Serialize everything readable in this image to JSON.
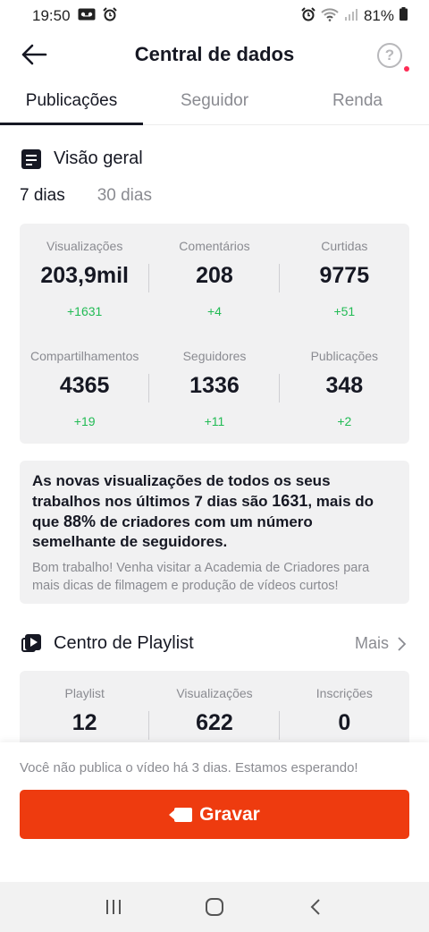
{
  "status_bar": {
    "time": "19:50",
    "battery": "81%"
  },
  "header": {
    "title": "Central de dados",
    "help_symbol": "?"
  },
  "tabs": [
    {
      "label": "Publicações",
      "active": true
    },
    {
      "label": "Seguidor",
      "active": false
    },
    {
      "label": "Renda",
      "active": false
    }
  ],
  "overview": {
    "title": "Visão geral",
    "periods": [
      {
        "label": "7 dias",
        "active": true
      },
      {
        "label": "30 dias",
        "active": false
      }
    ],
    "stats": [
      {
        "label": "Visualizações",
        "value": "203,9mil",
        "delta": "+1631"
      },
      {
        "label": "Comentários",
        "value": "208",
        "delta": "+4"
      },
      {
        "label": "Curtidas",
        "value": "9775",
        "delta": "+51"
      },
      {
        "label": "Compartilhamentos",
        "value": "4365",
        "delta": "+19"
      },
      {
        "label": "Seguidores",
        "value": "1336",
        "delta": "+11"
      },
      {
        "label": "Publicações",
        "value": "348",
        "delta": "+2"
      }
    ]
  },
  "info": {
    "part1": "As novas visualizações de todos os seus trabalhos nos últimos 7 dias são ",
    "views": "1631",
    "part2": ", mais do que ",
    "percent": "88%",
    "part3": " de criadores com um número semelhante de seguidores.",
    "sub": "Bom trabalho! Venha visitar a Academia de Criadores para mais dicas de filmagem e produção de vídeos curtos!"
  },
  "playlist": {
    "title": "Centro de Playlist",
    "more_label": "Mais",
    "stats": [
      {
        "label": "Playlist",
        "value": "12"
      },
      {
        "label": "Visualizações",
        "value": "622"
      },
      {
        "label": "Inscrições",
        "value": "0"
      }
    ]
  },
  "bottom": {
    "prompt": "Você não publica o vídeo há 3 dias. Estamos esperando!",
    "record_label": "Gravar"
  },
  "colors": {
    "accent": "#ee3b0f",
    "positive": "#22bb55",
    "notification": "#fe2c55"
  }
}
